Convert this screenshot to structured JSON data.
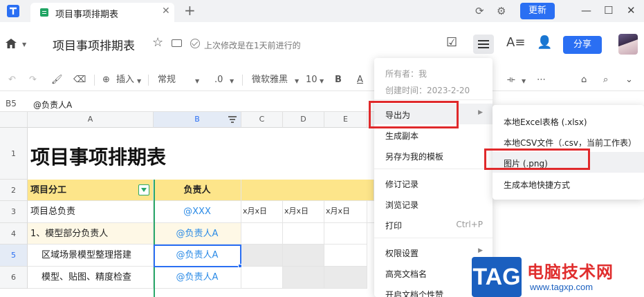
{
  "titlebar": {
    "tab_label": "项目事项排期表",
    "update_label": "更新"
  },
  "docbar": {
    "title": "项目事项排期表",
    "save_status": "上次修改是在1天前进行的",
    "share_label": "分享",
    "text_format_label": "A≡"
  },
  "toolbar": {
    "insert_label": "插入",
    "format_label": "常规",
    "decimal_label": ".0",
    "font_label": "微软雅黑",
    "size_label": "10",
    "bold_label": "B",
    "color_label": "A"
  },
  "formula": {
    "cell_ref": "B5",
    "value": "@负责人A"
  },
  "columns": [
    "A",
    "B",
    "C",
    "D",
    "E"
  ],
  "rows": [
    "1",
    "2",
    "3",
    "4",
    "5",
    "6"
  ],
  "sheet": {
    "title": "项目事项排期表",
    "header_a": "项目分工",
    "header_b": "负责人",
    "date_label": "x月x日",
    "r3_a": "项目总负责",
    "r3_b": "@XXX",
    "r4_a": "1、模型部分负责人",
    "r4_b": "@负责人A",
    "r5_a": "区域场景模型整理搭建",
    "r5_b": "@负责人A",
    "r6_a": "模型、贴图、精度检查",
    "r6_b": "@负责人A"
  },
  "menu": {
    "owner": "所有者：我",
    "created": "创建时间：2023-2-20",
    "items": [
      {
        "label": "导出为"
      },
      {
        "label": "生成副本"
      },
      {
        "label": "另存为我的模板"
      },
      {
        "label": "修订记录"
      },
      {
        "label": "浏览记录"
      },
      {
        "label": "打印",
        "shortcut": "Ctrl+P"
      },
      {
        "label": "权限设置"
      },
      {
        "label": "高亮文档名"
      },
      {
        "label": "开启文档个性赞"
      }
    ]
  },
  "submenu": {
    "items": [
      {
        "label": "本地Excel表格 (.xlsx)"
      },
      {
        "label": "本地CSV文件（.csv，当前工作表）"
      },
      {
        "label": "图片 (.png)"
      },
      {
        "label": "生成本地快捷方式"
      }
    ]
  },
  "watermark": {
    "badge": "TAG",
    "title": "电脑技术网",
    "url": "www.tagxp.com"
  },
  "colors": {
    "accent": "#2a6ff3",
    "header_yellow": "#fde58a",
    "highlight_red": "#e0292b",
    "mention_blue": "#2a8ae6"
  }
}
